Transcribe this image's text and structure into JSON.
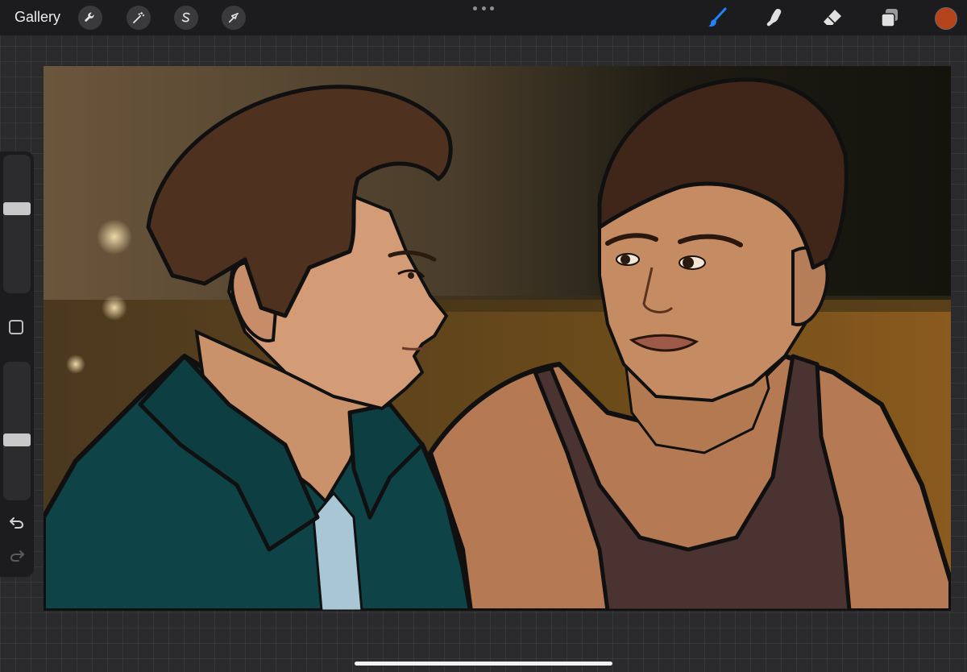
{
  "topbar": {
    "gallery_label": "Gallery",
    "left_tools": [
      {
        "name": "actions",
        "icon": "wrench-icon"
      },
      {
        "name": "adjustments",
        "icon": "magic-wand-icon"
      },
      {
        "name": "selection",
        "icon": "selection-s-icon"
      },
      {
        "name": "transform",
        "icon": "arrow-cursor-icon"
      }
    ],
    "more_icon": "more-dots-icon",
    "right_tools": [
      {
        "name": "brush",
        "icon": "brush-icon",
        "active": true
      },
      {
        "name": "smudge",
        "icon": "smudge-finger-icon",
        "active": false
      },
      {
        "name": "eraser",
        "icon": "eraser-icon",
        "active": false
      },
      {
        "name": "layers",
        "icon": "layers-icon",
        "active": false
      }
    ],
    "active_color": "#b5441c"
  },
  "sidebar": {
    "brush_size_level": 0.62,
    "opacity_level": 0.43,
    "modify_icon": "square-icon",
    "undo_icon": "undo-icon",
    "redo_icon": "redo-icon"
  },
  "canvas": {
    "artwork": "digital-painting-two-men"
  },
  "colors": {
    "toolbar_bg": "#1c1c1e",
    "brush_active": "#1e84ff",
    "workspace_bg": "#2b2b2d"
  }
}
